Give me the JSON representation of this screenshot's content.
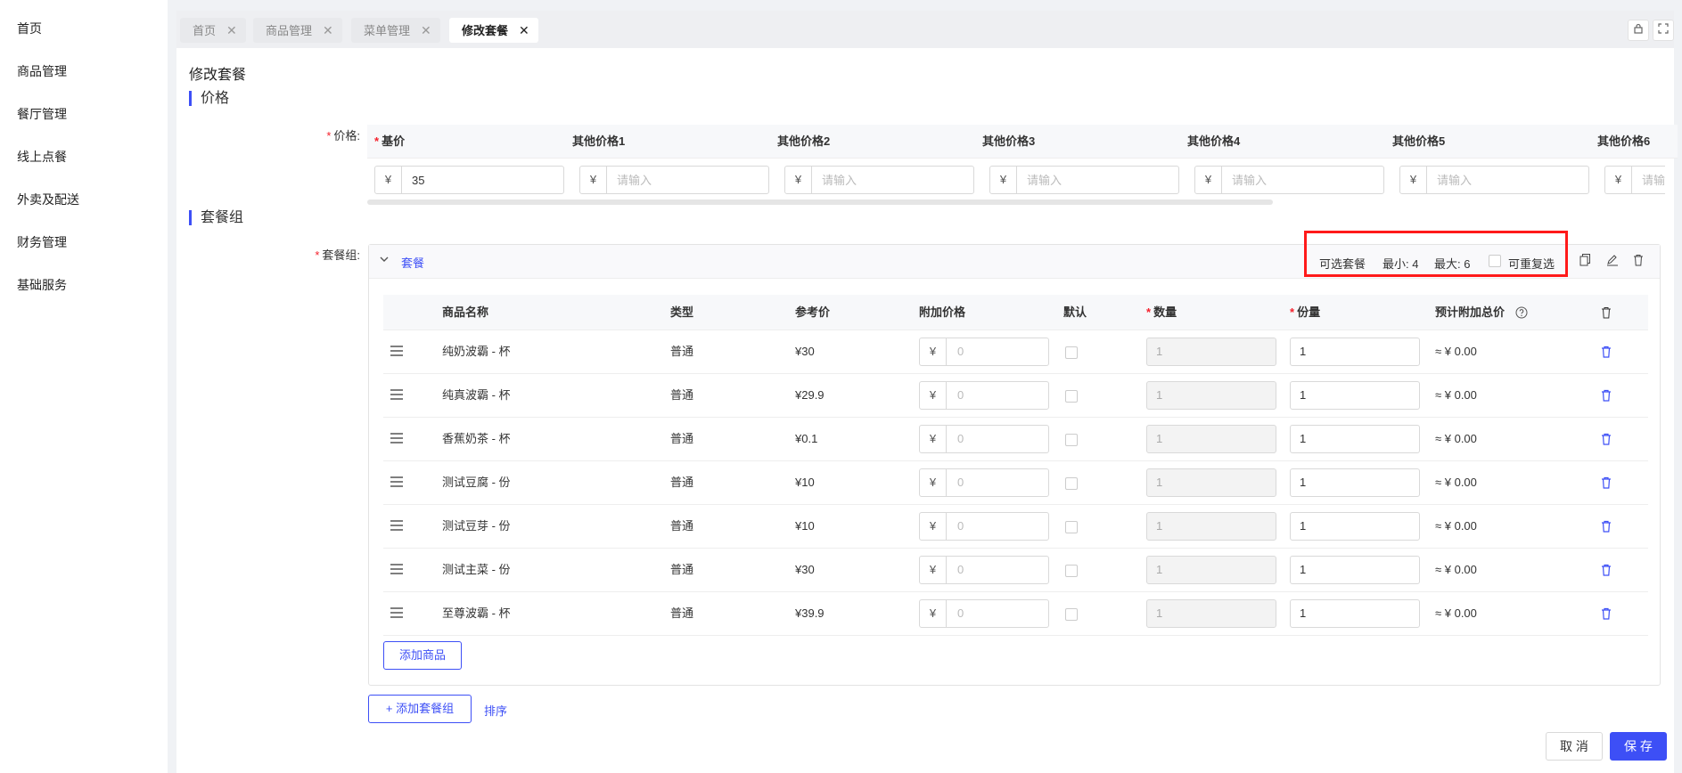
{
  "sidebar": {
    "items": [
      {
        "label": "首页"
      },
      {
        "label": "商品管理"
      },
      {
        "label": "餐厅管理"
      },
      {
        "label": "线上点餐"
      },
      {
        "label": "外卖及配送"
      },
      {
        "label": "财务管理"
      },
      {
        "label": "基础服务"
      }
    ]
  },
  "tabs": [
    {
      "label": "首页",
      "close": "✕"
    },
    {
      "label": "商品管理",
      "close": "✕"
    },
    {
      "label": "菜单管理",
      "close": "✕"
    },
    {
      "label": "修改套餐",
      "close": "✕",
      "active": true
    }
  ],
  "page": {
    "title": "修改套餐"
  },
  "price_section": {
    "title": "价格",
    "label": "价格:",
    "currency": "¥",
    "columns": [
      {
        "name": "基价",
        "required": true,
        "value": "35",
        "placeholder": ""
      },
      {
        "name": "其他价格1",
        "value": "",
        "placeholder": "请输入"
      },
      {
        "name": "其他价格2",
        "value": "",
        "placeholder": "请输入"
      },
      {
        "name": "其他价格3",
        "value": "",
        "placeholder": "请输入"
      },
      {
        "name": "其他价格4",
        "value": "",
        "placeholder": "请输入"
      },
      {
        "name": "其他价格5",
        "value": "",
        "placeholder": "请输入"
      },
      {
        "name": "其他价格6",
        "value": "",
        "placeholder": "请输"
      }
    ]
  },
  "group_section": {
    "title": "套餐组",
    "label": "套餐组:",
    "group": {
      "name": "套餐",
      "optional_label": "可选套餐",
      "min_label": "最小: 4",
      "max_label": "最大: 6",
      "repeat_label": "可重复选",
      "repeat_checked": false
    },
    "table": {
      "headers": {
        "name": "商品名称",
        "type": "类型",
        "ref_price": "参考价",
        "extra_price": "附加价格",
        "default": "默认",
        "quantity": "数量",
        "portion": "份量",
        "est_total": "预计附加总价"
      },
      "rows": [
        {
          "name": "纯奶波霸 - 杯",
          "type": "普通",
          "ref_price": "¥30",
          "currency": "¥",
          "extra_placeholder": "0",
          "quantity": "1",
          "portion": "1",
          "est_total": "≈ ¥ 0.00"
        },
        {
          "name": "纯真波霸 - 杯",
          "type": "普通",
          "ref_price": "¥29.9",
          "currency": "¥",
          "extra_placeholder": "0",
          "quantity": "1",
          "portion": "1",
          "est_total": "≈ ¥ 0.00"
        },
        {
          "name": "香蕉奶茶 - 杯",
          "type": "普通",
          "ref_price": "¥0.1",
          "currency": "¥",
          "extra_placeholder": "0",
          "quantity": "1",
          "portion": "1",
          "est_total": "≈ ¥ 0.00"
        },
        {
          "name": "测试豆腐 - 份",
          "type": "普通",
          "ref_price": "¥10",
          "currency": "¥",
          "extra_placeholder": "0",
          "quantity": "1",
          "portion": "1",
          "est_total": "≈ ¥ 0.00"
        },
        {
          "name": "测试豆芽 - 份",
          "type": "普通",
          "ref_price": "¥10",
          "currency": "¥",
          "extra_placeholder": "0",
          "quantity": "1",
          "portion": "1",
          "est_total": "≈ ¥ 0.00"
        },
        {
          "name": "测试主菜 - 份",
          "type": "普通",
          "ref_price": "¥30",
          "currency": "¥",
          "extra_placeholder": "0",
          "quantity": "1",
          "portion": "1",
          "est_total": "≈ ¥ 0.00"
        },
        {
          "name": "至尊波霸 - 杯",
          "type": "普通",
          "ref_price": "¥39.9",
          "currency": "¥",
          "extra_placeholder": "0",
          "quantity": "1",
          "portion": "1",
          "est_total": "≈ ¥ 0.00"
        }
      ]
    },
    "add_product_label": "添加商品",
    "add_group_label": "+ 添加套餐组",
    "sort_label": "排序"
  },
  "footer": {
    "cancel_label": "取 消",
    "save_label": "保 存"
  },
  "colors": {
    "accent": "#3d4ff6",
    "required": "#f5222d",
    "highlight": "#ff1a1a"
  }
}
